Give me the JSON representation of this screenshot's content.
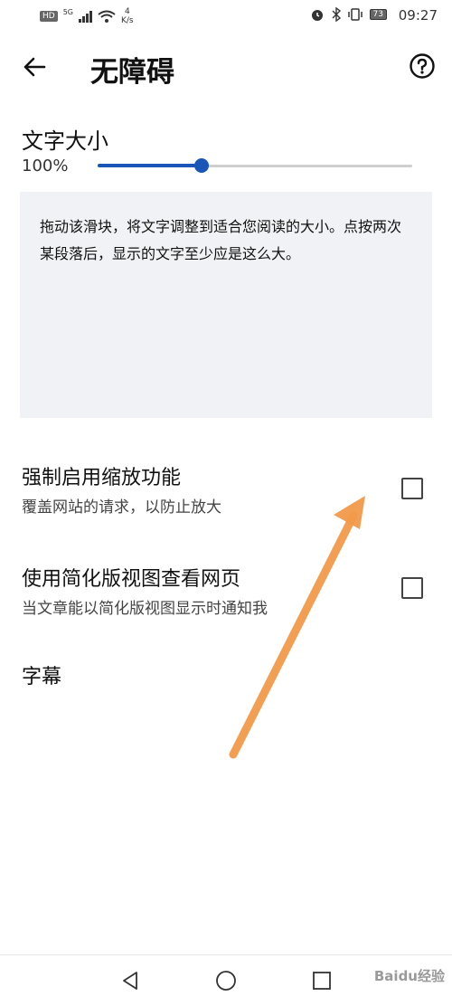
{
  "status_bar": {
    "hd": "HD",
    "network": "5G",
    "speed_value": "4",
    "speed_unit": "K/s",
    "battery": "73",
    "time": "09:27"
  },
  "app_bar": {
    "title": "无障碍",
    "back_icon": "arrow-left-icon",
    "help_icon": "help-circle-icon"
  },
  "text_size": {
    "label": "文字大小",
    "value": "100%",
    "slider_fraction": 0.33,
    "preview_text": "拖动该滑块，将文字调整到适合您阅读的大小。点按两次某段落后，显示的文字至少应是这么大。"
  },
  "settings": [
    {
      "title": "强制启用缩放功能",
      "subtitle": "覆盖网站的请求，以防止放大",
      "checked": false
    },
    {
      "title": "使用简化版视图查看网页",
      "subtitle": "当文章能以简化版视图显示时通知我",
      "checked": false
    }
  ],
  "captions": {
    "title": "字幕"
  },
  "colors": {
    "accent": "#1a56b7",
    "annotation_arrow": "#f29a4a",
    "preview_bg": "#f0f2f5"
  },
  "watermark": "Baidu经验"
}
